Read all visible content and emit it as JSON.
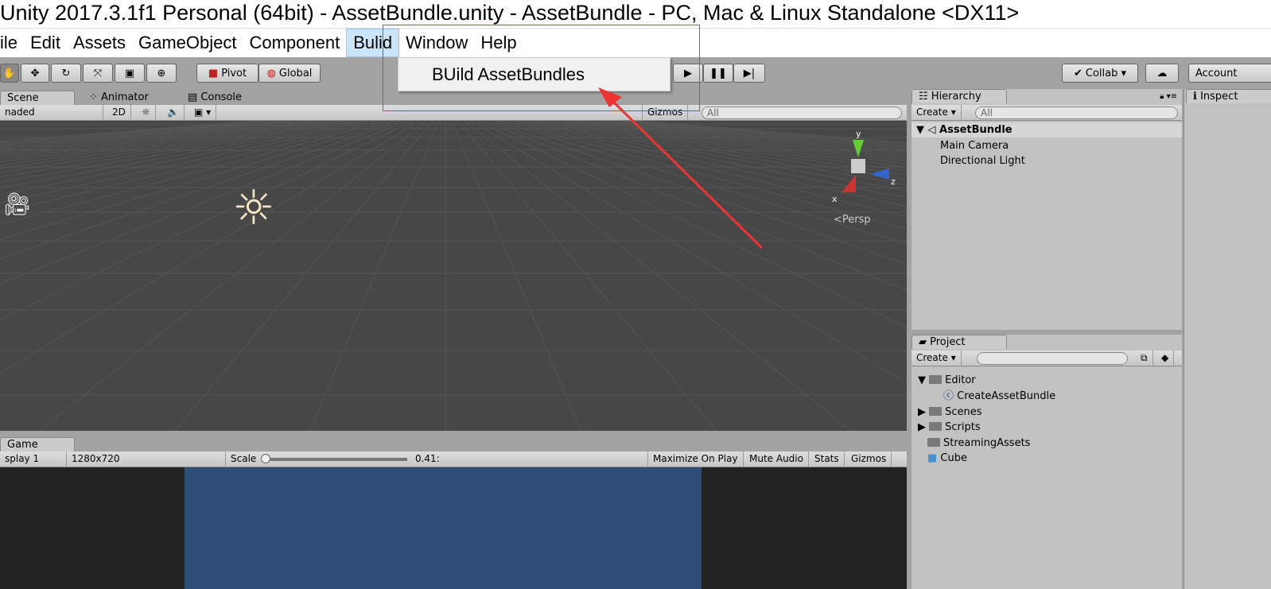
{
  "window": {
    "title": "Unity 2017.3.1f1 Personal (64bit) - AssetBundle.unity - AssetBundle - PC, Mac & Linux Standalone <DX11>"
  },
  "menu": {
    "items": [
      "ile",
      "Edit",
      "Assets",
      "GameObject",
      "Component",
      "Bulid",
      "Window",
      "Help"
    ],
    "active": "Bulid",
    "dropdown": {
      "items": [
        "BUild AssetBundles"
      ]
    }
  },
  "toolbar": {
    "pivot": "Pivot",
    "global": "Global",
    "collab": "Collab ▾",
    "account": "Account"
  },
  "scene": {
    "tabs": [
      "Scene",
      "Animator",
      "Console"
    ],
    "shading": "naded",
    "mode2d": "2D",
    "gizmos": "Gizmos",
    "search_placeholder": "All",
    "persp": "Persp",
    "axis": {
      "y": "y",
      "x": "x",
      "z": "z"
    }
  },
  "game": {
    "tab": "Game",
    "display": "splay 1",
    "resolution": "1280x720",
    "scale_label": "Scale",
    "scale_value": "0.41:",
    "scale_fraction": 0.0,
    "maximize": "Maximize On Play",
    "mute": "Mute Audio",
    "stats": "Stats",
    "gizmos": "Gizmos"
  },
  "hierarchy": {
    "tab": "Hierarchy",
    "create": "Create",
    "search_placeholder": "All",
    "scene": "AssetBundle",
    "items": [
      "Main Camera",
      "Directional Light"
    ]
  },
  "project": {
    "tab": "Project",
    "create": "Create",
    "items": [
      {
        "name": "Editor",
        "type": "folder",
        "expanded": true
      },
      {
        "name": "CreateAssetBundle",
        "type": "script"
      },
      {
        "name": "Scenes",
        "type": "folder"
      },
      {
        "name": "Scripts",
        "type": "folder"
      },
      {
        "name": "StreamingAssets",
        "type": "folder"
      },
      {
        "name": "Cube",
        "type": "prefab"
      }
    ]
  },
  "inspector": {
    "tab": "Inspect"
  },
  "colors": {
    "highlight": "#cce4f7",
    "annotation": "#e33333",
    "game_bg": "#2f4d77",
    "scene_bg": "#474747"
  }
}
